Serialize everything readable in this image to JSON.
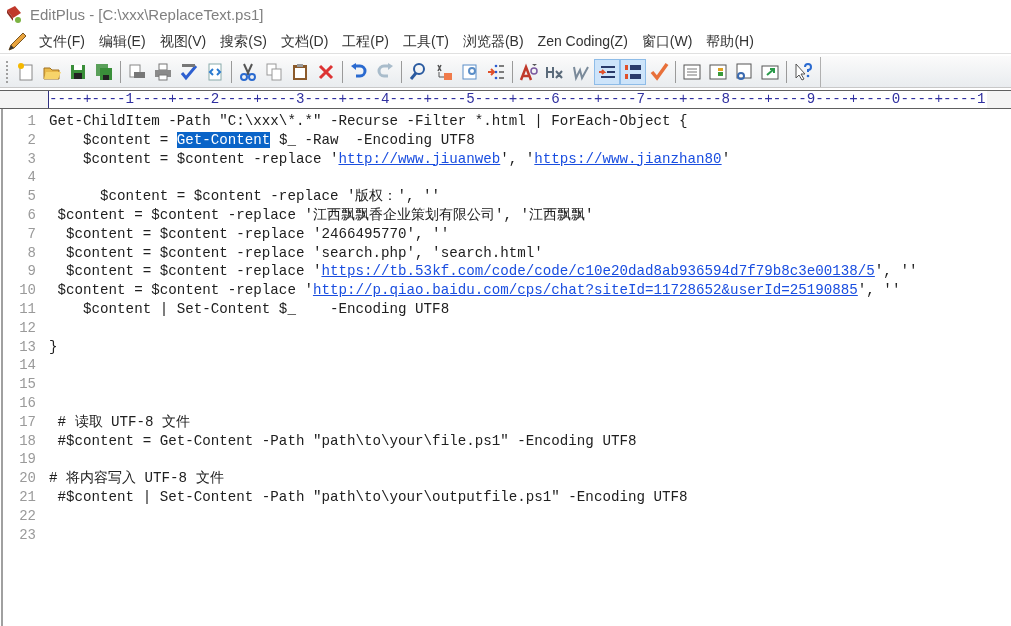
{
  "window": {
    "title": "EditPlus - [C:\\xxx\\ReplaceText.ps1]"
  },
  "menu": [
    "文件(F)",
    "编辑(E)",
    "视图(V)",
    "搜索(S)",
    "文档(D)",
    "工程(P)",
    "工具(T)",
    "浏览器(B)",
    "Zen Coding(Z)",
    "窗口(W)",
    "帮助(H)"
  ],
  "toolbar_groups": [
    [
      {
        "kind": "button"
      },
      {
        "kind": "button"
      },
      {
        "kind": "button"
      },
      {
        "kind": "button"
      }
    ],
    [
      {
        "kind": "button"
      },
      {
        "kind": "button"
      },
      {
        "kind": "button"
      },
      {
        "kind": "button"
      }
    ],
    [
      {
        "kind": "button"
      },
      {
        "kind": "button"
      },
      {
        "kind": "button"
      },
      {
        "kind": "button"
      }
    ],
    [
      {
        "kind": "button"
      },
      {
        "kind": "button"
      }
    ],
    [
      {
        "kind": "button"
      },
      {
        "kind": "button"
      },
      {
        "kind": "button"
      },
      {
        "kind": "button"
      }
    ],
    [
      {
        "kind": "button"
      },
      {
        "kind": "button"
      },
      {
        "kind": "button"
      },
      {
        "kind": "toggle",
        "pressed": true
      },
      {
        "kind": "toggle",
        "pressed": true
      },
      {
        "kind": "button"
      }
    ],
    [
      {
        "kind": "button"
      },
      {
        "kind": "button"
      },
      {
        "kind": "button"
      },
      {
        "kind": "button"
      }
    ],
    [
      {
        "kind": "button"
      }
    ]
  ],
  "ruler": "----+----1----+----2----+----3----+----4----+----5----+----6----+----7----+----8----+----9----+----0----+----1",
  "lines": [
    {
      "number": "1",
      "segments": [
        {
          "kind": "text",
          "text": "Get-ChildItem -Path \"C:\\xxx\\*.*\" -Recurse -Filter *.html | ForEach-Object {"
        }
      ]
    },
    {
      "number": "2",
      "segments": [
        {
          "kind": "text",
          "text": "    $content = "
        },
        {
          "kind": "selection",
          "text": "Get-Content"
        },
        {
          "kind": "text",
          "text": " $_ -Raw  -Encoding UTF8"
        }
      ]
    },
    {
      "number": "3",
      "segments": [
        {
          "kind": "text",
          "text": "    $content = $content -replace '"
        },
        {
          "kind": "link",
          "text": "http://www.jiuanweb"
        },
        {
          "kind": "text",
          "text": "', '"
        },
        {
          "kind": "link",
          "text": "https://www.jianzhan80"
        },
        {
          "kind": "text",
          "text": "'"
        }
      ]
    },
    {
      "number": "4"
    },
    {
      "number": "5",
      "segments": [
        {
          "kind": "text",
          "text": "      $content = $content -replace '版权：', ''"
        }
      ]
    },
    {
      "number": "6",
      "segments": [
        {
          "kind": "text",
          "text": " $content = $content -replace '江西飘飘香企业策划有限公司', '江西飘飘'"
        }
      ]
    },
    {
      "number": "7",
      "segments": [
        {
          "kind": "text",
          "text": "  $content = $content -replace '2466495770', ''"
        }
      ]
    },
    {
      "number": "8",
      "segments": [
        {
          "kind": "text",
          "text": "  $content = $content -replace 'search.php', 'search.html'"
        }
      ]
    },
    {
      "number": "9",
      "segments": [
        {
          "kind": "text",
          "text": "  $content = $content -replace '"
        },
        {
          "kind": "link",
          "text": "https://tb.53kf.com/code/code/c10e20dad8ab936594d7f79b8c3e00138/5"
        },
        {
          "kind": "text",
          "text": "', ''"
        }
      ]
    },
    {
      "number": "10",
      "segments": [
        {
          "kind": "text",
          "text": " $content = $content -replace '"
        },
        {
          "kind": "link",
          "text": "http://p.qiao.baidu.com/cps/chat?siteId=11728652&userId=25190885"
        },
        {
          "kind": "text",
          "text": "', ''"
        }
      ]
    },
    {
      "number": "11",
      "segments": [
        {
          "kind": "text",
          "text": "    $content | Set-Content $_    -Encoding UTF8"
        }
      ]
    },
    {
      "number": "12"
    },
    {
      "number": "13",
      "segments": [
        {
          "kind": "text",
          "text": "}"
        }
      ]
    },
    {
      "number": "14"
    },
    {
      "number": "15"
    },
    {
      "number": "16"
    },
    {
      "number": "17",
      "segments": [
        {
          "kind": "text",
          "text": " # 读取 UTF-8 文件"
        }
      ]
    },
    {
      "number": "18",
      "segments": [
        {
          "kind": "text",
          "text": " #$content = Get-Content -Path \"path\\to\\your\\file.ps1\" -Encoding UTF8"
        }
      ]
    },
    {
      "number": "19"
    },
    {
      "number": "20",
      "segments": [
        {
          "kind": "text",
          "text": "# 将内容写入 UTF-8 文件"
        }
      ]
    },
    {
      "number": "21",
      "segments": [
        {
          "kind": "text",
          "text": " #$content | Set-Content -Path \"path\\to\\your\\outputfile.ps1\" -Encoding UTF8"
        }
      ]
    },
    {
      "number": "22"
    },
    {
      "number": "23"
    }
  ]
}
